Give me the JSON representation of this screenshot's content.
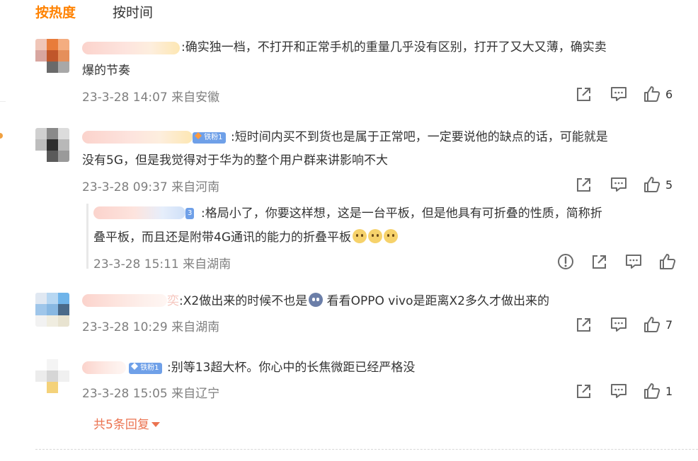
{
  "sort_tabs": {
    "hot": "按热度",
    "time": "按时间"
  },
  "colors": {
    "accent": "#ff8200",
    "link": "#eb7350",
    "meta": "#7f7f7f",
    "badge": "#6fa0e8"
  },
  "comments": [
    {
      "text_line1": ":确实独一档，不打开和正常手机的重量几乎没有区别，打开了又大又薄，确实卖",
      "text_line2": "爆的节奏",
      "time": "23-3-28 14:07 来自安徽",
      "likes": "6"
    },
    {
      "badge": "铁粉1",
      "text_line1": ":短时间内买不到货也是属于正常吧，一定要说他的缺点的话，可能就是",
      "text_line2": "没有5G，但是我觉得对于华为的整个用户群来讲影响不大",
      "time": "23-3-28 09:37 来自河南",
      "likes": "5"
    },
    {
      "badge_fragment": "3",
      "text_line1": ":格局小了，你要这样想，这是一台平板，但是他具有可折叠的性质，简称折",
      "text_line2": "叠平板，而且还是附带4G通讯的能力的折叠平板",
      "time": "23-3-28 15:11 来自湖南"
    },
    {
      "name_fragment": "奕",
      "text_part1": ":X2做出来的时候不也是",
      "text_part2": " 看看OPPO vivo是距离X2多久才做出来的",
      "time": "23-3-28 10:29 来自湖南",
      "likes": "7"
    },
    {
      "badge": "铁粉1",
      "text_line1": ":别等13超大杯。你心中的长焦微距已经严格没",
      "time": "23-3-28 15:05 来自辽宁",
      "likes": "1"
    }
  ],
  "more_replies": "共5条回复",
  "icons": {
    "share": "share-icon",
    "comment": "comment-icon",
    "like": "thumbs-up-icon",
    "report": "report-icon"
  }
}
